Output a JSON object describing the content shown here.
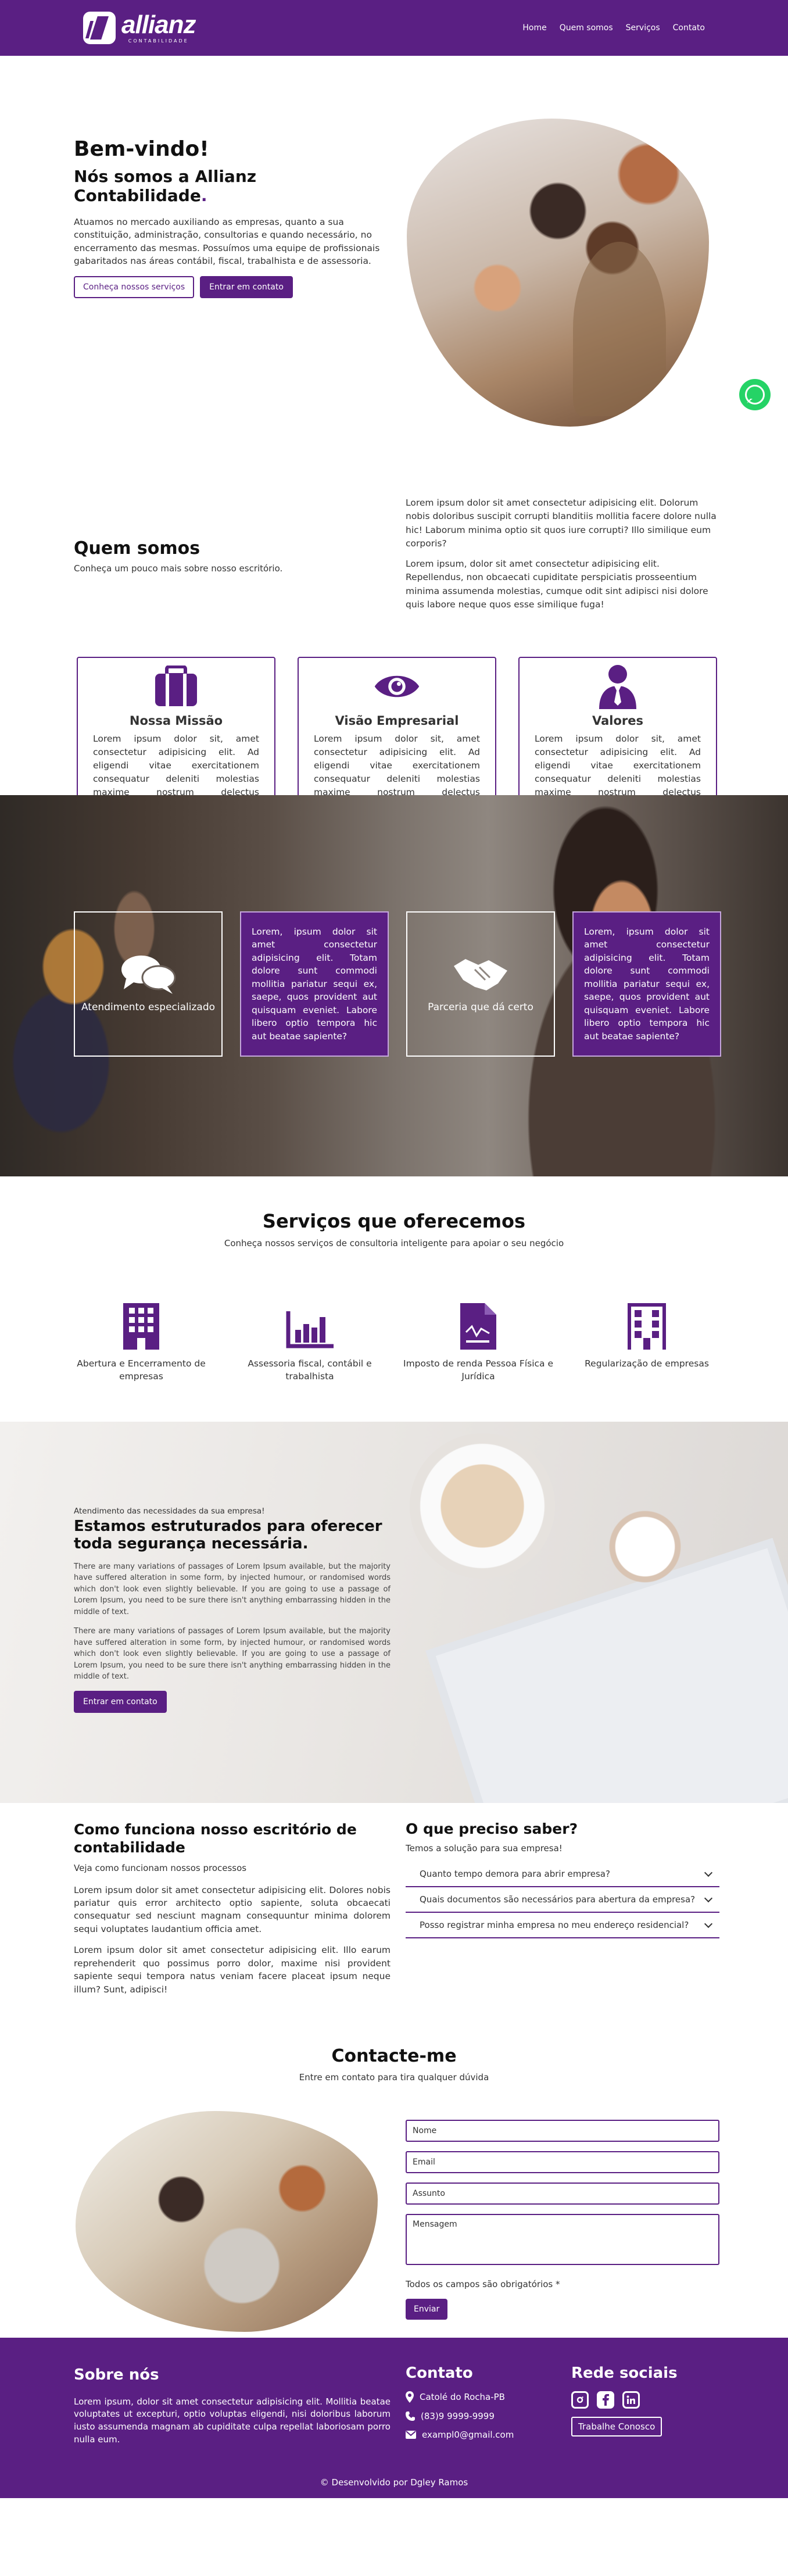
{
  "nav": {
    "logo_name": "allianz",
    "logo_sub": "CONTABILIDADE",
    "links": [
      "Home",
      "Quem somos",
      "Serviços",
      "Contato"
    ]
  },
  "hero": {
    "title": "Bem-vindo!",
    "subtitle": "Nós somos a Allianz Contabilidade",
    "subtitle_dot": ".",
    "description": "Atuamos no mercado auxiliando as empresas, quanto a sua constituição, administração, consultorias e quando necessário, no encerramento das mesmas. Possuímos uma equipe de profissionais gabaritados nas áreas contábil, fiscal, trabalhista e de assessoria.",
    "btn_services": "Conheça nossos serviços",
    "btn_contact": "Entrar em contato"
  },
  "about": {
    "title": "Quem somos",
    "subtitle": "Conheça um pouco mais sobre nosso escritório.",
    "p1": "Lorem ipsum dolor sit amet consectetur adipisicing elit. Dolorum nobis doloribus suscipit corrupti blanditiis mollitia facere dolore nulla hic! Laborum minima optio sit quos iure corrupti? Illo similique eum corporis?",
    "p2": "Lorem ipsum, dolor sit amet consectetur adipisicing elit. Repellendus, non obcaecati cupiditate perspiciatis prosseentium minima assumenda molestias, cumque odit sint adipisci nisi dolore quis labore neque quos esse similique fuga!",
    "cards": [
      {
        "title": "Nossa Missão",
        "text": "Lorem ipsum dolor sit, amet consectetur adipisicing elit. Ad eligendi vitae exercitationem consequatur deleniti molestias maxime nostrum delectus perspiciatis?"
      },
      {
        "title": "Visão Empresarial",
        "text": "Lorem ipsum dolor sit, amet consectetur adipisicing elit. Ad eligendi vitae exercitationem consequatur deleniti molestias maxime nostrum delectus perspiciatis?"
      },
      {
        "title": "Valores",
        "text": "Lorem ipsum dolor sit, amet consectetur adipisicing elit. Ad eligendi vitae exercitationem consequatur deleniti molestias maxime nostrum delectus perspiciatis?"
      }
    ]
  },
  "banner": {
    "tile1_label": "Atendimento especializado",
    "tile2_text": "Lorem, ipsum dolor sit amet consectetur adipisicing elit. Totam dolore sunt commodi mollitia pariatur sequi ex, saepe, quos provident aut quisquam eveniet. Labore libero optio tempora hic aut beatae sapiente?",
    "tile3_label": "Parceria que dá certo",
    "tile4_text": "Lorem, ipsum dolor sit amet consectetur adipisicing elit. Totam dolore sunt commodi mollitia pariatur sequi ex, saepe, quos provident aut quisquam eveniet. Labore libero optio tempora hic aut beatae sapiente?"
  },
  "services": {
    "title": "Serviços que oferecemos",
    "subtitle": "Conheça nossos serviços de consultoria inteligente para apoiar o seu negócio",
    "items": [
      "Abertura e Encerramento de empresas",
      "Assessoria fiscal, contábil e trabalhista",
      "Imposto de renda Pessoa Física e Jurídica",
      "Regularização de empresas"
    ]
  },
  "structured": {
    "kicker": "Atendimento das necessidades da sua empresa!",
    "title": "Estamos estruturados para oferecer toda segurança necessária.",
    "p1": "There are many variations of passages of Lorem Ipsum available, but the majority have suffered alteration in some form, by injected humour, or randomised words which don't look even slightly believable. If you are going to use a passage of Lorem Ipsum, you need to be sure there isn't anything embarrassing hidden in the middle of text.",
    "p2": "There are many variations of passages of Lorem Ipsum available, but the majority have suffered alteration in some form, by injected humour, or randomised words which don't look even slightly believable. If you are going to use a passage of Lorem Ipsum, you need to be sure there isn't anything embarrassing hidden in the middle of text.",
    "button": "Entrar em contato"
  },
  "how": {
    "title": "Como funciona nosso escritório de contabilidade",
    "subtitle": "Veja como funcionam nossos processos",
    "p1": "Lorem ipsum dolor sit amet consectetur adipisicing elit. Dolores nobis pariatur quis error architecto optio sapiente, soluta obcaecati consequatur sed nesciunt magnam consequuntur minima dolorem sequi voluptates laudantium officia amet.",
    "p2": "Lorem ipsum dolor sit amet consectetur adipisicing elit. Illo earum reprehenderit quo possimus porro dolor, maxime nisi provident sapiente sequi tempora natus veniam facere placeat ipsum neque illum? Sunt, adipisci!"
  },
  "faq": {
    "title": "O que preciso saber?",
    "subtitle": "Temos a solução para sua empresa!",
    "items": [
      "Quanto tempo demora para abrir empresa?",
      "Quais documentos são necessários para abertura da empresa?",
      "Posso registrar minha empresa no meu endereço residencial?"
    ]
  },
  "contact": {
    "title": "Contacte-me",
    "subtitle": "Entre em contato para tira qualquer dúvida",
    "name_ph": "Nome",
    "email_ph": "Email",
    "subject_ph": "Assunto",
    "message_ph": "Mensagem",
    "note": "Todos os campos são obrigatórios *",
    "send": "Enviar"
  },
  "footer": {
    "about_title": "Sobre nós",
    "about_text": "Lorem ipsum, dolor sit amet consectetur adipisicing elit. Mollitia beatae voluptates ut excepturi, optio voluptas eligendi, nisi doloribus laborum iusto assumenda magnam ab cupiditate culpa repellat laboriosam porro nulla eum.",
    "contact_title": "Contato",
    "city": "Catolé do Rocha-PB",
    "phone": "(83)9 9999-9999",
    "email": "exampl0@gmail.com",
    "social_title": "Rede sociais",
    "work_btn": "Trabalhe Conosco",
    "credits": "© Desenvolvido por Dgley Ramos"
  }
}
